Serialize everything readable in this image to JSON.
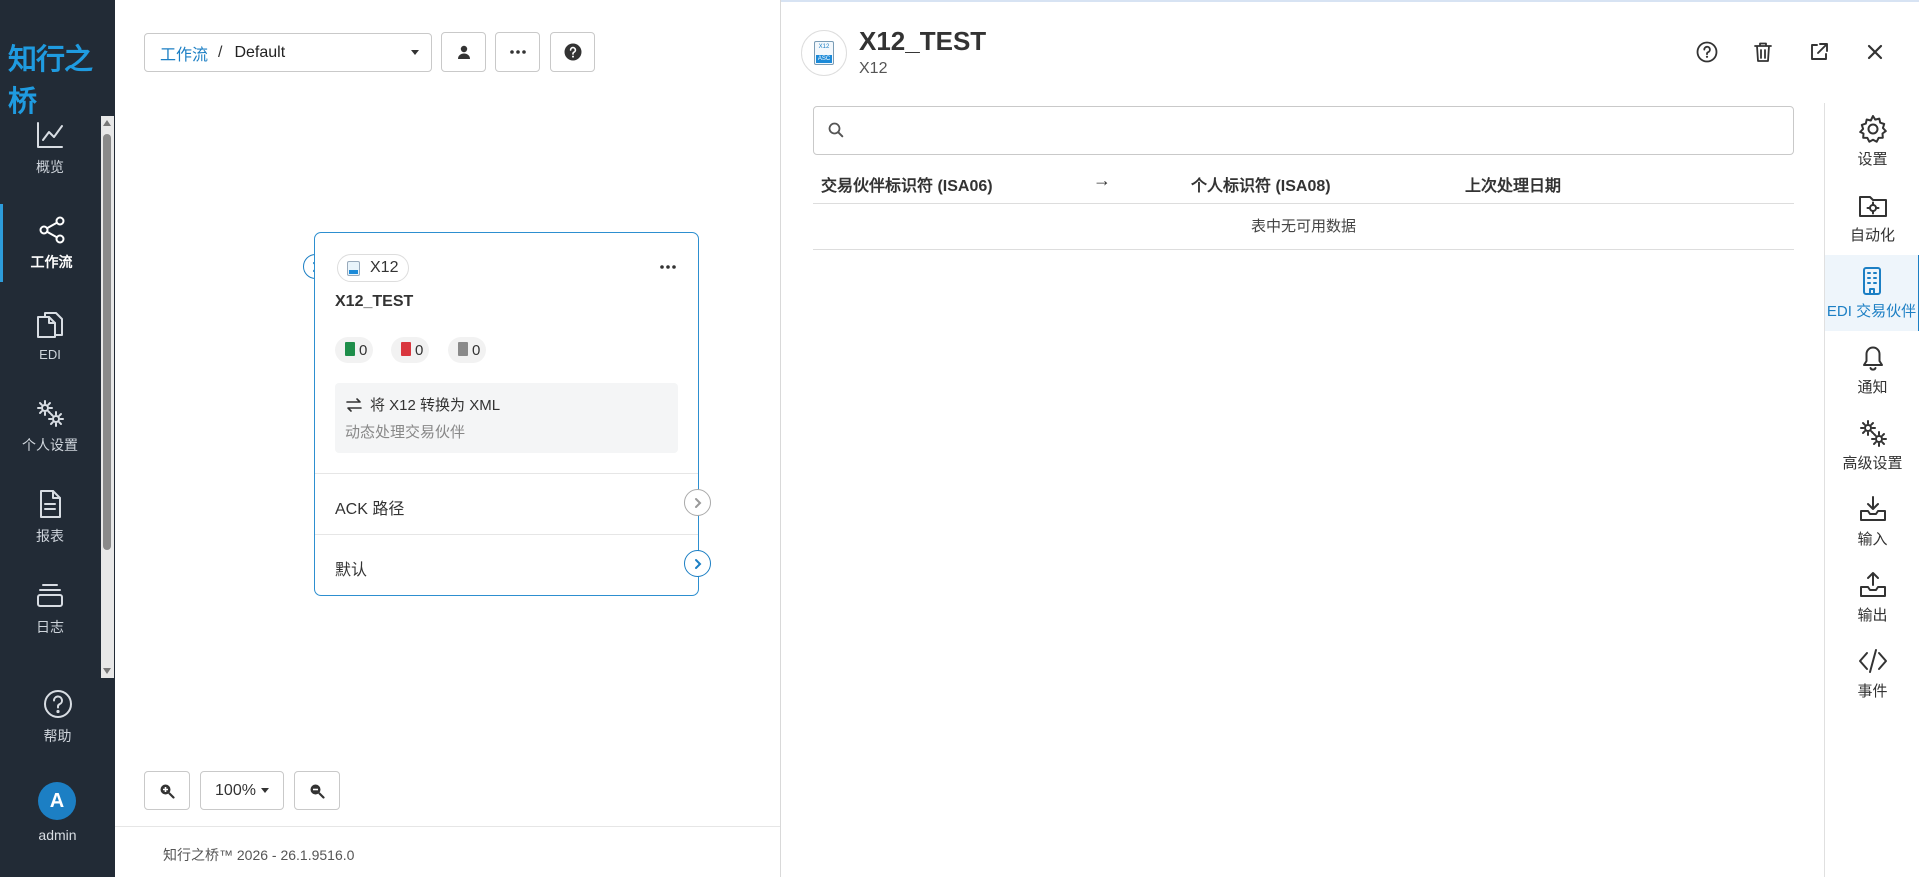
{
  "app": {
    "logo_text": "知行之桥",
    "version_footer": "知行之桥™ 2026 - 26.1.9516.0"
  },
  "sidebar": {
    "items": [
      {
        "label": "概览",
        "icon": "chart-line-icon"
      },
      {
        "label": "工作流",
        "icon": "share-nodes-icon",
        "active": true
      },
      {
        "label": "EDI",
        "icon": "copy-files-icon"
      },
      {
        "label": "个人设置",
        "icon": "gears-icon"
      },
      {
        "label": "报表",
        "icon": "file-lines-icon"
      },
      {
        "label": "日志",
        "icon": "layers-icon"
      }
    ],
    "help_label": "帮助",
    "user": {
      "initial": "A",
      "name": "admin"
    }
  },
  "canvas": {
    "breadcrumb": {
      "root": "工作流",
      "separator": "/",
      "current": "Default"
    },
    "node": {
      "tag": "X12",
      "title": "X12_TEST",
      "counts": {
        "success": "0",
        "error": "0",
        "pending": "0"
      },
      "description": "将 X12 转换为 XML",
      "subdescription": "动态处理交易伙伴",
      "outputs": [
        {
          "label": "ACK 路径"
        },
        {
          "label": "默认"
        }
      ]
    },
    "zoom": "100%"
  },
  "panel": {
    "title": "X12_TEST",
    "subtitle": "X12",
    "search": {
      "placeholder": "",
      "value": ""
    },
    "table": {
      "columns": [
        "交易伙伴标识符 (ISA06)",
        "→",
        "个人标识符 (ISA08)",
        "上次处理日期"
      ],
      "empty_text": "表中无可用数据"
    }
  },
  "toolbar": {
    "items": [
      {
        "label": "设置",
        "icon": "gear-icon"
      },
      {
        "label": "自动化",
        "icon": "folder-gear-icon"
      },
      {
        "label": "EDI 交易伙伴",
        "icon": "building-icon",
        "active": true
      },
      {
        "label": "通知",
        "icon": "bell-icon"
      },
      {
        "label": "高级设置",
        "icon": "gears-icon"
      },
      {
        "label": "输入",
        "icon": "inbox-in-icon"
      },
      {
        "label": "输出",
        "icon": "inbox-out-icon"
      },
      {
        "label": "事件",
        "icon": "code-icon"
      }
    ]
  },
  "colors": {
    "sidebar_bg": "#222b36",
    "accent": "#1c7fc4",
    "success": "#1e8e4a",
    "error": "#d9363e"
  }
}
